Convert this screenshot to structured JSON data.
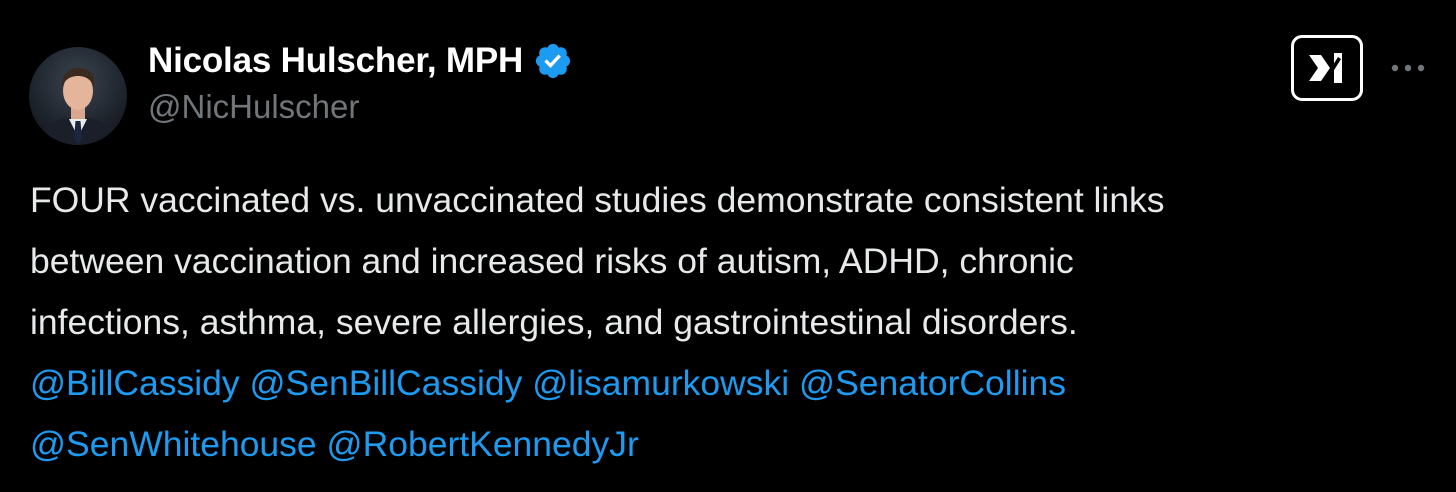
{
  "author": {
    "display_name": "Nicolas Hulscher, MPH",
    "handle": "@NicHulscher",
    "verified": true,
    "avatar_icon": "profile-photo"
  },
  "header": {
    "logo_icon": "xai-grok-icon",
    "more_icon": "more-options-icon"
  },
  "tweet": {
    "text_lines": [
      "FOUR vaccinated vs. unvaccinated studies demonstrate consistent links",
      "between vaccination and increased risks of autism, ADHD, chronic",
      "infections, asthma, severe allergies, and gastrointestinal disorders."
    ],
    "mentions_line1": [
      "@BillCassidy",
      "@SenBillCassidy",
      "@lisamurkowski",
      "@SenatorCollins"
    ],
    "mentions_line2": [
      "@SenWhitehouse",
      "@RobertKennedyJr"
    ]
  },
  "colors": {
    "background": "#000000",
    "text": "#e7e9ea",
    "name": "#ffffff",
    "handle": "#71767b",
    "mention": "#1d9bf0",
    "verified_badge": "#1d9bf0"
  }
}
